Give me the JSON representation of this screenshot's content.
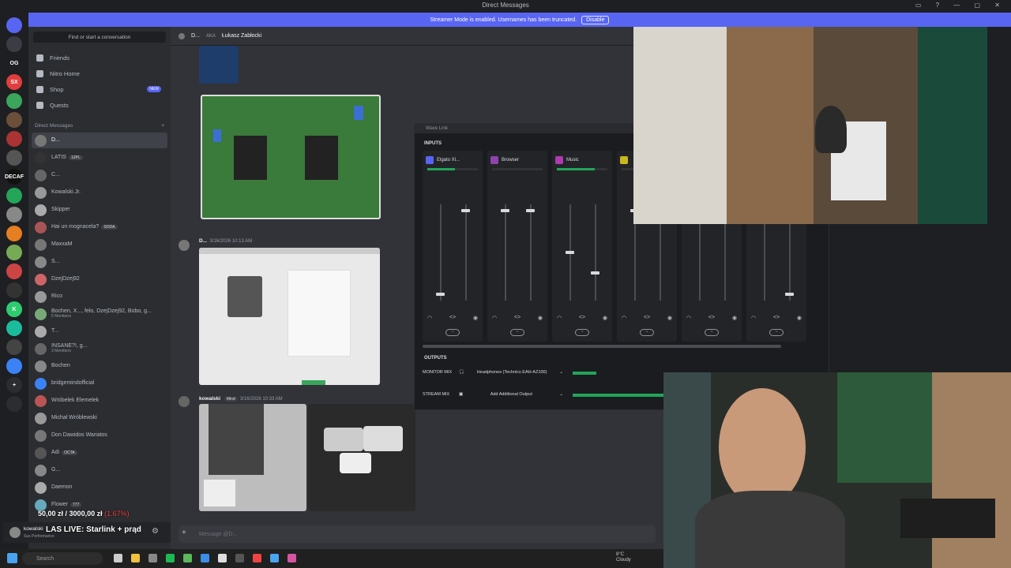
{
  "window": {
    "title": "Direct Messages"
  },
  "banner": {
    "text": "Streamer Mode is enabled. Usernames has been truncated.",
    "button": "Disable"
  },
  "servers": [
    {
      "label": "",
      "color": "#5865f2"
    },
    {
      "label": "",
      "color": "#3a3d44"
    },
    {
      "label": "OG",
      "color": "#1e1f22"
    },
    {
      "label": "SX",
      "color": "#e03e3e"
    },
    {
      "label": "",
      "color": "#3ba55c"
    },
    {
      "label": "",
      "color": "#6b4f3a"
    },
    {
      "label": "",
      "color": "#a33"
    },
    {
      "label": "",
      "color": "#555"
    },
    {
      "label": "DECAF",
      "color": "#111"
    },
    {
      "label": "",
      "color": "#23a55a"
    },
    {
      "label": "",
      "color": "#888"
    },
    {
      "label": "",
      "color": "#e67e22"
    },
    {
      "label": "",
      "color": "#7a5"
    },
    {
      "label": "",
      "color": "#c44"
    },
    {
      "label": "",
      "color": "#333"
    },
    {
      "label": "K",
      "color": "#2ecc71"
    },
    {
      "label": "",
      "color": "#1abc9c"
    },
    {
      "label": "",
      "color": "#444"
    },
    {
      "label": "",
      "color": "#3b82f6"
    },
    {
      "label": "+",
      "color": "#2b2d31"
    },
    {
      "label": "",
      "color": "#2b2d31"
    }
  ],
  "sidebar": {
    "search": "Find or start a conversation",
    "nav": [
      {
        "label": "Friends"
      },
      {
        "label": "Nitro Home"
      },
      {
        "label": "Shop",
        "badge": "NEW"
      },
      {
        "label": "Quests"
      }
    ],
    "dm_header": "Direct Messages",
    "dm_add": "+",
    "dms": [
      {
        "name": "D...",
        "sub": "",
        "tag": "",
        "color": "#777"
      },
      {
        "name": "LATIS",
        "sub": "",
        "tag": "12PL",
        "color": "#333"
      },
      {
        "name": "C...",
        "sub": "",
        "tag": "",
        "color": "#666"
      },
      {
        "name": "Kowalski.Jr.",
        "sub": "",
        "tag": "",
        "color": "#999"
      },
      {
        "name": "Skipper",
        "sub": "",
        "tag": "",
        "color": "#aaa"
      },
      {
        "name": "Hai un mognacela?",
        "sub": "",
        "tag": "SODA",
        "color": "#a55"
      },
      {
        "name": "MaxxaM",
        "sub": "",
        "tag": "",
        "color": "#777"
      },
      {
        "name": "S...",
        "sub": "",
        "tag": "",
        "color": "#888"
      },
      {
        "name": "DzejDzej92",
        "sub": "",
        "tag": "",
        "color": "#c66"
      },
      {
        "name": "Rico",
        "sub": "",
        "tag": "",
        "color": "#999"
      },
      {
        "name": "Bochen, X..., felo, DzejDzej92, Bobo, g...",
        "sub": "5 Members",
        "tag": "",
        "color": "#7a7"
      },
      {
        "name": "T...",
        "sub": "",
        "tag": "",
        "color": "#aaa"
      },
      {
        "name": "INSANE?!, g...",
        "sub": "3 Members",
        "tag": "",
        "color": "#666"
      },
      {
        "name": "Bochen",
        "sub": "",
        "tag": "",
        "color": "#888"
      },
      {
        "name": "bridgemindofficial",
        "sub": "",
        "tag": "",
        "color": "#3b82f6"
      },
      {
        "name": "Wróbelek Elemelek",
        "sub": "",
        "tag": "",
        "color": "#b55"
      },
      {
        "name": "Michał Wróblewski",
        "sub": "",
        "tag": "",
        "color": "#999"
      },
      {
        "name": "Don Dawidos Wariatos",
        "sub": "",
        "tag": "",
        "color": "#777"
      },
      {
        "name": "Adi",
        "sub": "",
        "tag": "OCTA",
        "color": "#555"
      },
      {
        "name": "G...",
        "sub": "",
        "tag": "",
        "color": "#888"
      },
      {
        "name": "Daemon",
        "sub": "",
        "tag": "",
        "color": "#aaa"
      },
      {
        "name": "Flower",
        "sub": "",
        "tag": "777",
        "color": "#6ab"
      }
    ]
  },
  "userpanel": {
    "name": "kowalski",
    "status": "Sus Performance"
  },
  "overlay": {
    "money": "50,00 zł",
    "sep": " / ",
    "goal": "3000,00 zł",
    "pct": "(1.67%)",
    "live": "LAS LIVE: Starlink + prąd"
  },
  "chat": {
    "header_name": "D...",
    "header_aka": "AKA",
    "header_alias": "Łukasz Zabłocki",
    "msg1": {
      "author": "D...",
      "time": "3/16/2026 10:13 AM"
    },
    "msg2": {
      "author": "kowalski",
      "tag": "Mind",
      "time": "3/16/2026 10:33 AM"
    },
    "composer_placeholder": "Message @D..."
  },
  "mixer": {
    "title": "Wave Link",
    "inputs_label": "INPUTS",
    "outputs_label": "OUTPUTS",
    "channels": [
      {
        "name": "Elgato Xl...",
        "chip": "#5865f2",
        "level": 0.55,
        "fader_a": 0.05,
        "fader_b": 0.95
      },
      {
        "name": "Browser",
        "chip": "#8e44ad",
        "level": 0.0,
        "fader_a": 0.95,
        "fader_b": 0.95
      },
      {
        "name": "Music",
        "chip": "#b03ab0",
        "level": 0.75,
        "fader_a": 0.5,
        "fader_b": 0.28
      },
      {
        "name": "",
        "chip": "#c8b820",
        "level": 0.0,
        "fader_a": 0.95,
        "fader_b": 0.95
      },
      {
        "name": "",
        "chip": "#555",
        "level": 0.0,
        "fader_a": 0.95,
        "fader_b": 0.95
      },
      {
        "name": "",
        "chip": "#555",
        "level": 0.0,
        "fader_a": 0.95,
        "fader_b": 0.05
      }
    ],
    "outputs": [
      {
        "label": "MONITOR MIX",
        "device": "Headphones (Technics EAH-AZ100)",
        "level": 0.1
      },
      {
        "label": "STREAM MIX",
        "device": "Add Additional Output",
        "level": 0.4
      }
    ]
  },
  "taskbar": {
    "search": "Search",
    "weather_temp": "8°C",
    "weather_desc": "Cloudy"
  }
}
